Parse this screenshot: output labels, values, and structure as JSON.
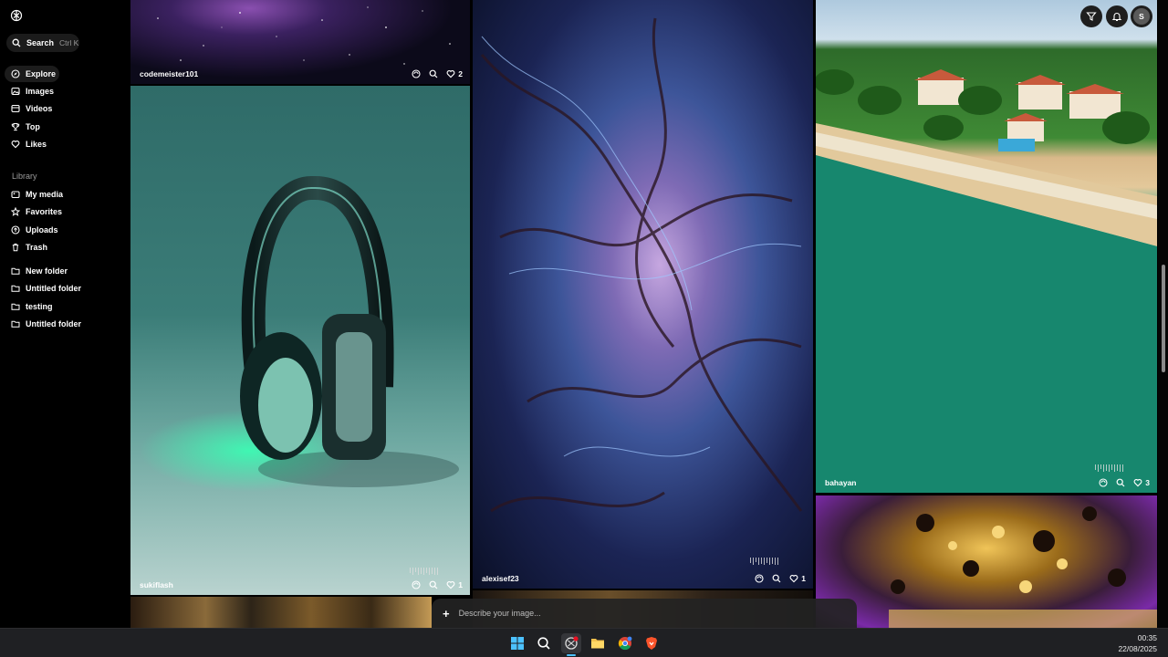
{
  "sidebar": {
    "search": {
      "label": "Search",
      "shortcut": "Ctrl K"
    },
    "nav": [
      {
        "label": "Explore",
        "icon": "compass-icon",
        "active": true
      },
      {
        "label": "Images",
        "icon": "image-icon"
      },
      {
        "label": "Videos",
        "icon": "video-icon"
      },
      {
        "label": "Top",
        "icon": "trophy-icon"
      },
      {
        "label": "Likes",
        "icon": "heart-icon"
      }
    ],
    "library_label": "Library",
    "library": [
      {
        "label": "My media",
        "icon": "media-icon"
      },
      {
        "label": "Favorites",
        "icon": "star-icon"
      },
      {
        "label": "Uploads",
        "icon": "upload-icon"
      },
      {
        "label": "Trash",
        "icon": "trash-icon"
      }
    ],
    "folders": [
      {
        "label": "New folder",
        "icon": "folder-icon"
      },
      {
        "label": "Untitled folder",
        "icon": "folder-icon"
      },
      {
        "label": "testing",
        "icon": "folder-icon"
      },
      {
        "label": "Untitled folder",
        "icon": "folder-icon"
      }
    ]
  },
  "gallery": {
    "tiles": [
      {
        "author": "codemeister101",
        "likes": "2"
      },
      {
        "author": "sukiflash",
        "likes": "1"
      },
      {
        "author": "alexisef23",
        "likes": "1"
      },
      {
        "author": "bahayan",
        "likes": "3"
      }
    ]
  },
  "header": {
    "avatar_initial": "S"
  },
  "prompt": {
    "plus": "+",
    "placeholder": "Describe your image..."
  },
  "taskbar": {
    "time": "00:35",
    "date": "22/08/2025"
  }
}
